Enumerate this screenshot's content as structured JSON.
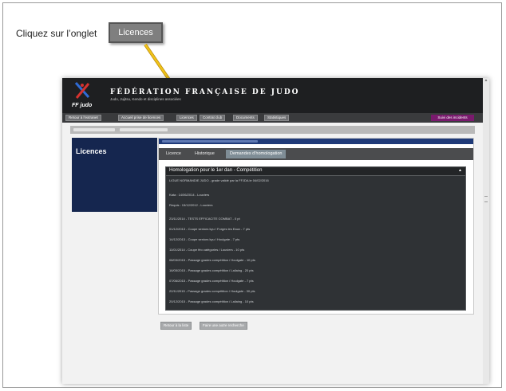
{
  "instruction": {
    "text": "Cliquez sur l’onglet",
    "callout_label": "Licences"
  },
  "header": {
    "org_title": "FÉDÉRATION FRANÇAISE DE JUDO",
    "org_subtitle": "Judo, Jujitsu, Kendo et disciplines associées",
    "logo_text": "FF judo"
  },
  "nav": {
    "items": [
      "Retour à l’extranet",
      "Accueil prise de licences",
      "Licences",
      "Contrat club",
      "Documents",
      "Statistiques"
    ],
    "incidents": "Suivi des incidents"
  },
  "sidebar": {
    "title": "Licences"
  },
  "tabs": [
    {
      "label": "Licence"
    },
    {
      "label": "Historique"
    },
    {
      "label": "Demandes d’homologation",
      "active": true
    }
  ],
  "panel": {
    "title": "Homologation pour le 1er dan - Compétition",
    "caret": "▲",
    "validation": "LIGUE NORMANDIE JUDO - grade validé par la FFJDA le 04/02/2016",
    "kata": "Kata : 14/06/2014 - Louviers",
    "requis": "Requis : 15/12/2012 - Louviers",
    "entries": [
      "23/11/2014 - TESTS EFFICACITE COMBAT - 0 pt",
      "01/12/2013 - Coupe seniors kyu / Forges les Eaux - 7 pts",
      "14/12/2013 - Coupe seniors kyu / Houlgate - 7 pts",
      "11/01/2014 - Coupe féo catégories / Louviers - 10 pts",
      "08/03/2015 - Passage grades compétition / Houlgate - 10 pts",
      "16/05/2015 - Passage grades compétition / Lallaing - 20 pts",
      "07/06/2015 - Passage grades compétition / Houlgate - 7 pts",
      "22/11/2015 - Passage grades compétition / Houlgate - 30 pts",
      "20/12/2015 - Passage grades compétition / Lallaing - 10 pts"
    ]
  },
  "buttons": {
    "back": "Retour à la liste",
    "new_search": "Faire une autre recherche"
  },
  "colors": {
    "header_bg": "#1e1f21",
    "sidebar_bg": "#15264f",
    "incidents_bg": "#7a1a6e",
    "arrow": "#f0c419"
  }
}
